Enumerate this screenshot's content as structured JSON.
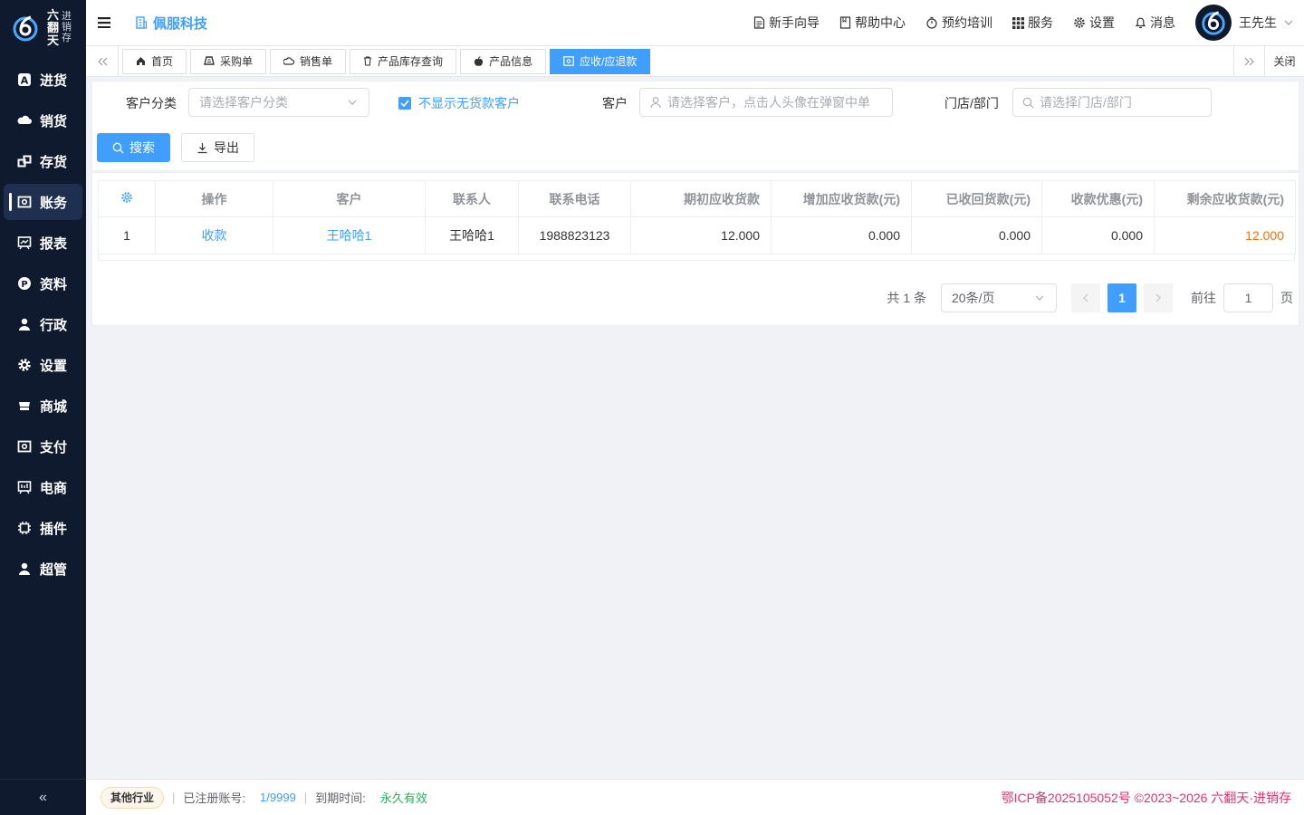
{
  "brand": {
    "big_chars": [
      "六",
      "翻",
      "天"
    ],
    "small_chars": [
      "进",
      "销",
      "存"
    ]
  },
  "sidebar": {
    "items": [
      {
        "label": "进货",
        "icon": "letter-a-icon"
      },
      {
        "label": "销货",
        "icon": "cloud-icon"
      },
      {
        "label": "存货",
        "icon": "boxes-icon"
      },
      {
        "label": "账务",
        "icon": "ledger-icon"
      },
      {
        "label": "报表",
        "icon": "chart-board-icon"
      },
      {
        "label": "资料",
        "icon": "letter-p-icon"
      },
      {
        "label": "行政",
        "icon": "user-icon"
      },
      {
        "label": "设置",
        "icon": "gear-icon"
      },
      {
        "label": "商城",
        "icon": "shop-icon"
      },
      {
        "label": "支付",
        "icon": "payment-icon"
      },
      {
        "label": "电商",
        "icon": "ecommerce-icon"
      },
      {
        "label": "插件",
        "icon": "plugin-icon"
      },
      {
        "label": "超管",
        "icon": "admin-icon"
      }
    ],
    "active_index": 3,
    "collapse_glyph": "«"
  },
  "header": {
    "company": "佩服科技",
    "links": [
      "新手向导",
      "帮助中心",
      "预约培训",
      "服务",
      "设置",
      "消息"
    ],
    "user_name": "王先生"
  },
  "tabs": {
    "items": [
      "首页",
      "采购单",
      "销售单",
      "产品库存查询",
      "产品信息",
      "应收/应退款"
    ],
    "active_index": 5,
    "close_label": "关闭"
  },
  "filter": {
    "category_label": "客户分类",
    "category_placeholder": "请选择客户分类",
    "hide_zero_label": "不显示无货款客户",
    "hide_zero_checked": true,
    "customer_label": "客户",
    "customer_placeholder": "请选择客户，点击人头像在弹窗中单",
    "store_label": "门店/部门",
    "store_placeholder": "请选择门店/部门",
    "search_label": "搜索",
    "export_label": "导出"
  },
  "table": {
    "columns": [
      "操作",
      "客户",
      "联系人",
      "联系电话",
      "期初应收货款",
      "增加应收货款(元)",
      "已收回货款(元)",
      "收款优惠(元)",
      "剩余应收货款(元)"
    ],
    "rows": [
      {
        "index": "1",
        "action": "收款",
        "customer": "王哈哈1",
        "contact": "王哈哈1",
        "phone": "1988823123",
        "opening": "12.000",
        "added": "0.000",
        "received": "0.000",
        "discount": "0.000",
        "remaining": "12.000"
      }
    ]
  },
  "pagination": {
    "total_prefix": "共",
    "total": "1",
    "total_suffix": "条",
    "page_size": "20条/页",
    "current_page": "1",
    "goto_label": "前往",
    "goto_value": "1",
    "page_suffix": "页"
  },
  "footer": {
    "industry": "其他行业",
    "registered_label": "已注册账号:",
    "registered_value": "1/9999",
    "expire_label": "到期时间:",
    "expire_value": "永久有效",
    "icp": "鄂ICP备2025105052号 ©2023~2026 六翻天·进销存"
  },
  "colors": {
    "primary": "#409eff",
    "sidebar_bg": "#0f1a2e",
    "remaining_amount": "#f2710c",
    "icp_text": "#e62f6e",
    "expire_text": "#1db35a"
  }
}
